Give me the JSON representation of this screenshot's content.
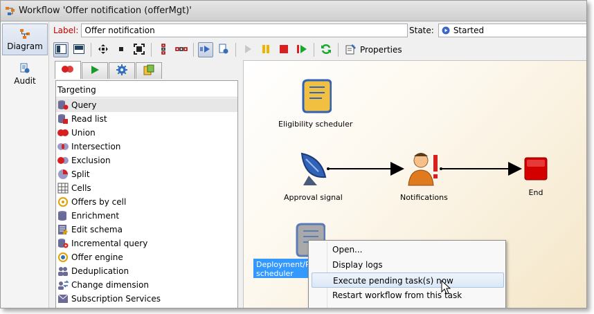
{
  "window": {
    "title": "Workflow 'Offer notification (offerMgt)'"
  },
  "nav": {
    "items": [
      {
        "label": "Diagram"
      },
      {
        "label": "Audit"
      }
    ]
  },
  "form": {
    "label_caption": "Label:",
    "label_value": "Offer notification",
    "state_caption": "State:",
    "state_value": "Started"
  },
  "toolbar": {
    "properties_label": "Properties"
  },
  "palette": {
    "header": "Targeting",
    "items": [
      {
        "label": "Query"
      },
      {
        "label": "Read list"
      },
      {
        "label": "Union"
      },
      {
        "label": "Intersection"
      },
      {
        "label": "Exclusion"
      },
      {
        "label": "Split"
      },
      {
        "label": "Cells"
      },
      {
        "label": "Offers by cell"
      },
      {
        "label": "Enrichment"
      },
      {
        "label": "Edit schema"
      },
      {
        "label": "Incremental query"
      },
      {
        "label": "Offer engine"
      },
      {
        "label": "Deduplication"
      },
      {
        "label": "Change dimension"
      },
      {
        "label": "Subscription Services"
      }
    ]
  },
  "diagram": {
    "nodes": [
      {
        "label": "Eligibility scheduler"
      },
      {
        "label": "Approval signal"
      },
      {
        "label": "Notifications"
      },
      {
        "label": "End"
      },
      {
        "label": "Deployment/Publication scheduler"
      }
    ]
  },
  "context_menu": {
    "items": [
      {
        "label": "Open..."
      },
      {
        "label": "Display logs"
      },
      {
        "label": "Execute pending task(s) now"
      },
      {
        "label": "Restart workflow from this task"
      }
    ]
  },
  "colors": {
    "accent": "#3399ff",
    "label_red": "#c00000",
    "end_red": "#d40000"
  }
}
